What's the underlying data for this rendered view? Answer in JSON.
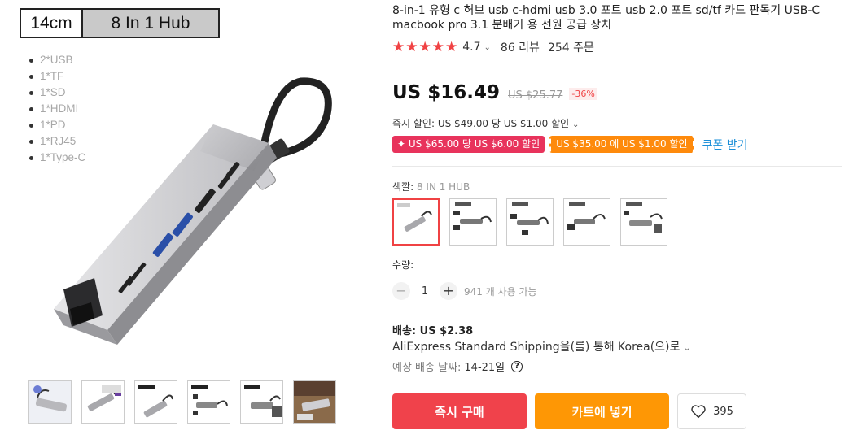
{
  "gallery": {
    "spec_size": "14cm",
    "spec_model": "8 In 1 Hub",
    "ports": [
      "2*USB",
      "1*TF",
      "1*SD",
      "1*HDMI",
      "1*PD",
      "1*RJ45",
      "1*Type-C"
    ],
    "thumbnail_count": 6
  },
  "product": {
    "title": "8-in-1 유형 c 허브 usb c-hdmi usb 3.0 포트 usb 2.0 포트 sd/tf 카드 판독기 USB-C macbook pro 3.1 분배기 용 전원 공급 장치",
    "rating": "4.7",
    "rating_stars": 5,
    "reviews": "86 리뷰",
    "orders": "254 주문",
    "price": "US $16.49",
    "original_price": "US $25.77",
    "discount": "-36%",
    "instant_discount": "즉시 할인: US $49.00 당 US $1.00 할인",
    "coupon_1": "✦ US $65.00 당 US $6.00 할인",
    "coupon_2": "US $35.00 에 US $1.00 할인",
    "coupon_link": "쿠폰 받기",
    "color_label": "색깔:",
    "color_value": "8 IN 1 HUB",
    "swatch_count": 5,
    "quantity_label": "수량:",
    "quantity": "1",
    "stock": "941 개 사용 가능",
    "shipping_title": "배송: US $2.38",
    "shipping_method": "AliExpress Standard Shipping을(를) 통해 Korea(으)로",
    "eta_label": "예상 배송 날짜:",
    "eta_value": "14-21일",
    "buy_now": "즉시 구매",
    "add_to_cart": "카트에 넣기",
    "wishlist_count": "395"
  },
  "colors": {
    "accent_red": "#f04244",
    "buy_red": "#f0424b",
    "cart_orange": "#fe9705",
    "coupon_pink": "#e8335c",
    "coupon_orange": "#fe8a0c",
    "link_blue": "#1a8fd8"
  },
  "icons": {
    "star": "star-icon",
    "heart": "heart-icon",
    "help": "question-circle-icon",
    "chevron": "chevron-down-icon",
    "minus": "minus-icon",
    "plus": "plus-icon"
  }
}
